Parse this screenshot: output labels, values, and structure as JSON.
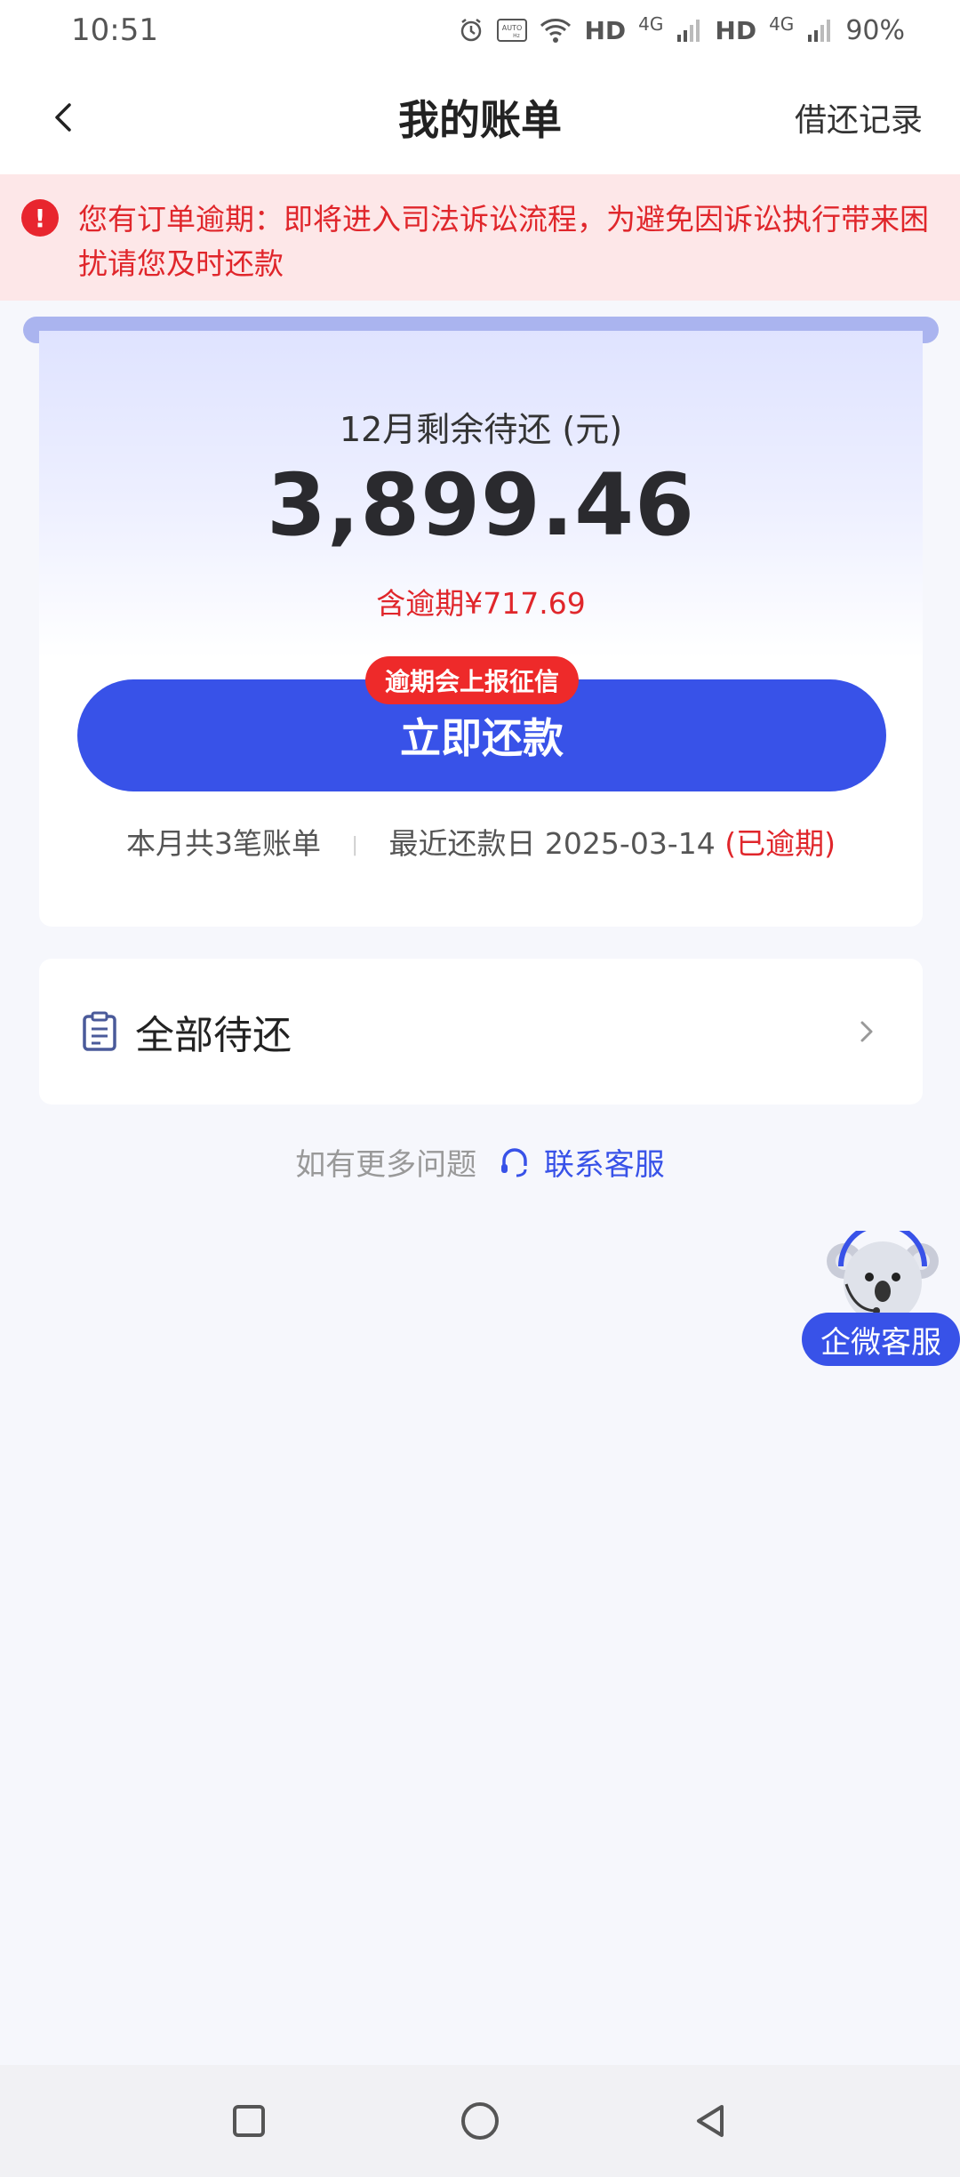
{
  "status_bar": {
    "time": "10:51",
    "hd1": "HD",
    "net1": "4G",
    "hd2": "HD",
    "net2": "4G",
    "battery": "90%"
  },
  "nav": {
    "title": "我的账单",
    "right_link": "借还记录"
  },
  "alert": {
    "icon_text": "!",
    "message": "您有订单逾期：即将进入司法诉讼流程，为避免因诉讼执行带来困扰请您及时还款"
  },
  "summary": {
    "label": "12月剩余待还 (元)",
    "amount": "3,899.46",
    "overdue": "含逾期¥717.69",
    "badge": "逾期会上报征信",
    "pay_button": "立即还款",
    "bill_count": "本月共3笔账单",
    "separator": "|",
    "recent_due": "最近还款日 2025-03-14",
    "overdue_status": "(已逾期)"
  },
  "pending_row": {
    "label": "全部待还"
  },
  "help": {
    "text": "如有更多问题",
    "contact": "联系客服"
  },
  "float_service": {
    "label": "企微客服"
  },
  "colors": {
    "primary": "#3852e8",
    "danger": "#e0262b",
    "alert_bg": "#fde7e8",
    "page_bg": "#f6f7fc"
  }
}
